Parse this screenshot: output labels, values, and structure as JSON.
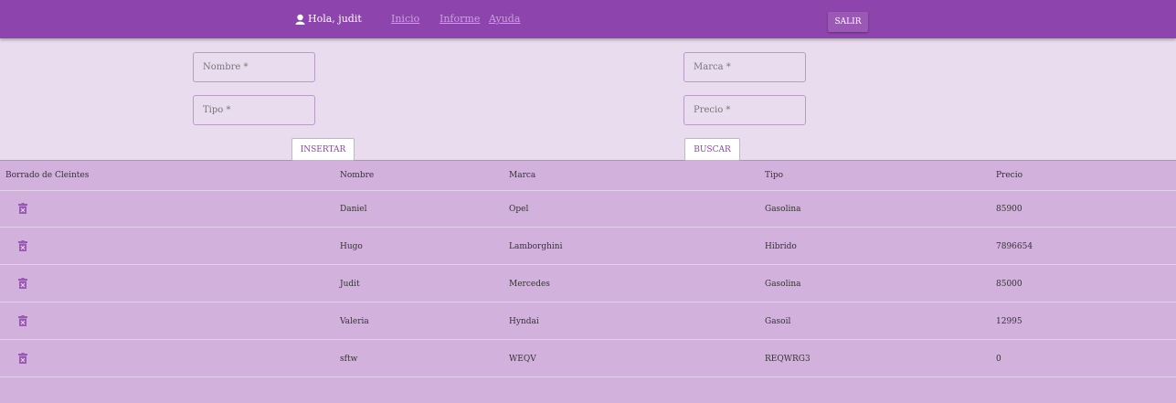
{
  "header": {
    "greeting": "Hola, judit",
    "nav": [
      {
        "label": "Inicio"
      },
      {
        "label": "Informe"
      },
      {
        "label": "Ayuda"
      }
    ],
    "logout_label": "SALIR"
  },
  "form": {
    "nombre_placeholder": "Nombre *",
    "marca_placeholder": "Marca *",
    "tipo_placeholder": "Tipo *",
    "precio_placeholder": "Precio *",
    "insert_label": "INSERTAR",
    "search_label": "BUSCAR"
  },
  "table": {
    "columns": [
      "Borrado de Cleintes",
      "Nombre",
      "Marca",
      "Tipo",
      "Precio"
    ],
    "rows": [
      {
        "nombre": "Daniel",
        "marca": "Opel",
        "tipo": "Gasolina",
        "precio": "85900"
      },
      {
        "nombre": "Hugo",
        "marca": "Lamborghini",
        "tipo": "Hibrido",
        "precio": "7896654"
      },
      {
        "nombre": "Judit",
        "marca": "Mercedes",
        "tipo": "Gasolina",
        "precio": "85000"
      },
      {
        "nombre": "Valeria",
        "marca": "Hyndai",
        "tipo": "Gasoil",
        "precio": "12995"
      },
      {
        "nombre": "sftw",
        "marca": "WEQV",
        "tipo": "REQWRG3",
        "precio": "0"
      }
    ]
  },
  "colors": {
    "header": "#8e44ad",
    "form_bg": "#e9dcef",
    "table_bg": "#d2b1dc",
    "accent": "#9b59b6"
  },
  "icons": {
    "user": "user-icon",
    "delete": "trash-icon"
  }
}
